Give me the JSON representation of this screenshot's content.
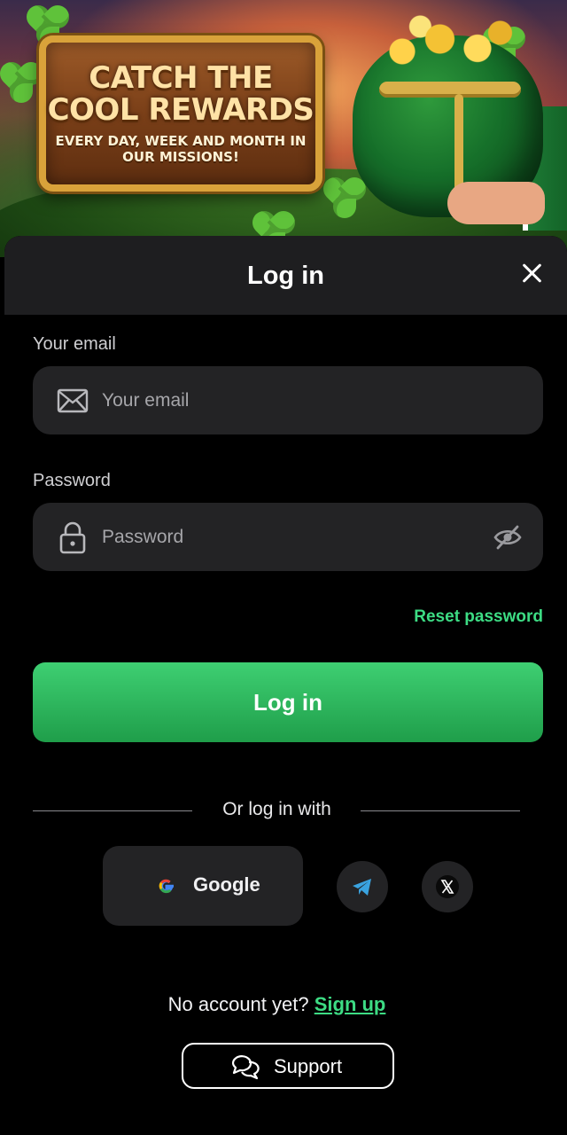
{
  "banner": {
    "headline": "CATCH THE COOL REWARDS",
    "subline": "EVERY DAY, WEEK AND MONTH IN OUR MISSIONS!"
  },
  "modal": {
    "title": "Log in",
    "email": {
      "label": "Your email",
      "placeholder": "Your email",
      "value": ""
    },
    "password": {
      "label": "Password",
      "placeholder": "Password",
      "value": ""
    },
    "reset_link": "Reset password",
    "submit_label": "Log in",
    "divider_text": "Or log in with",
    "social": {
      "google_label": "Google",
      "telegram_icon": "telegram-icon",
      "x_icon": "x-logo-icon"
    },
    "signup": {
      "prompt": "No account yet?",
      "link": "Sign up"
    },
    "support_label": "Support"
  },
  "colors": {
    "accent": "#3ddc84",
    "button_top": "#3ecf72",
    "button_bottom": "#1f9e4a",
    "field_bg": "#232325",
    "header_bg": "#1e1e20"
  }
}
